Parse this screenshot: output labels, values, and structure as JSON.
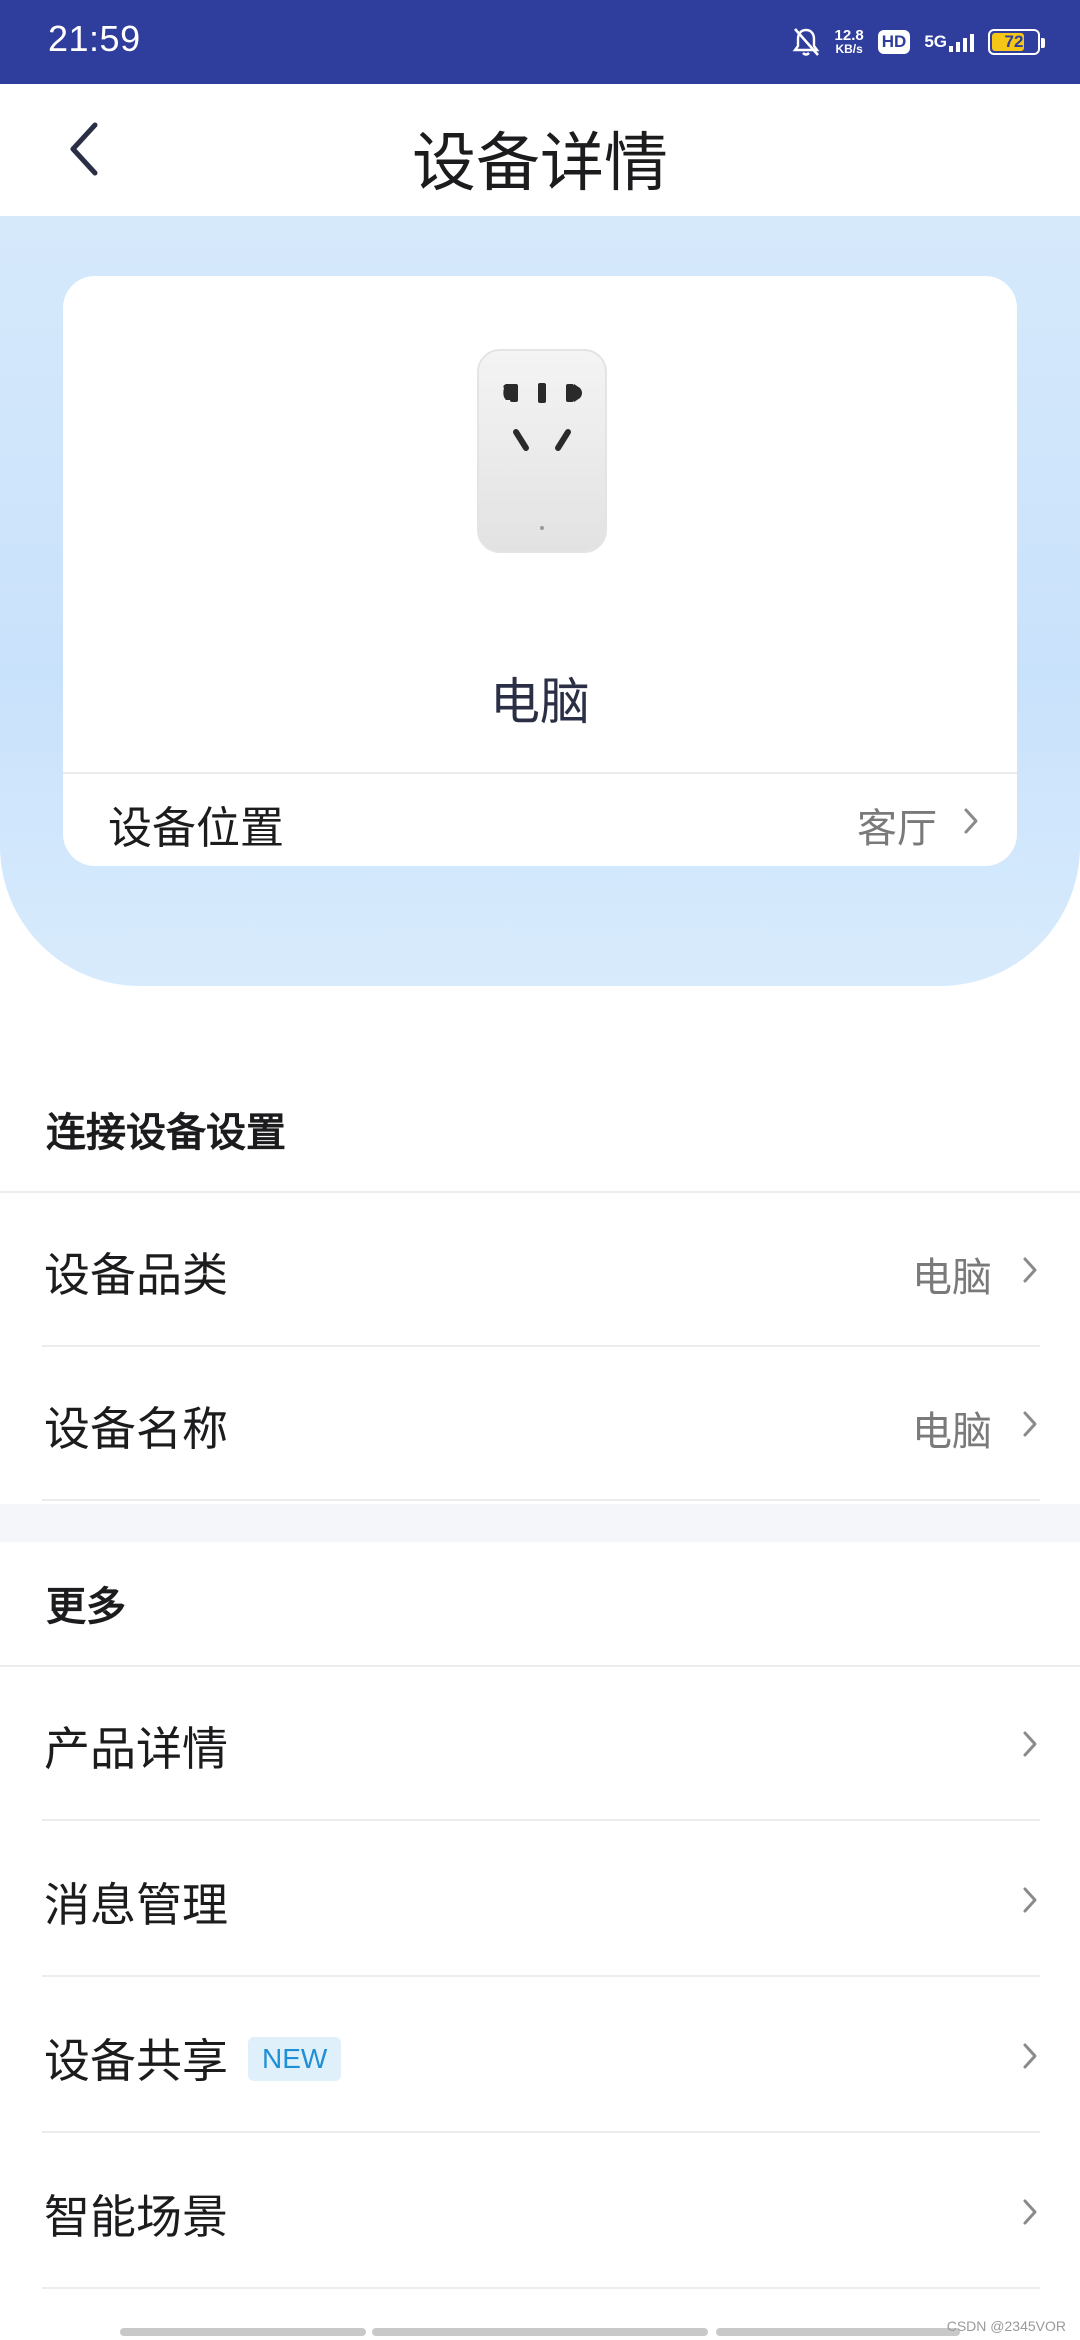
{
  "status_bar": {
    "time": "21:59",
    "speed_value": "12.8",
    "speed_unit": "KB/s",
    "hd": "HD",
    "network": "5G",
    "battery": "72",
    "battery_level": 0.72,
    "icons": [
      "bell-muted-icon",
      "signal-icon",
      "battery-icon"
    ]
  },
  "header": {
    "title": "设备详情",
    "back_icon": "chevron-left-icon"
  },
  "device": {
    "name": "电脑",
    "image": "smart-plug-image",
    "location_label": "设备位置",
    "location_value": "客厅"
  },
  "sections": {
    "connect": {
      "title": "连接设备设置",
      "rows": [
        {
          "label": "设备品类",
          "value": "电脑"
        },
        {
          "label": "设备名称",
          "value": "电脑"
        }
      ]
    },
    "more": {
      "title": "更多",
      "rows": [
        {
          "label": "产品详情"
        },
        {
          "label": "消息管理"
        },
        {
          "label": "设备共享",
          "badge": "NEW"
        },
        {
          "label": "智能场景"
        }
      ]
    }
  },
  "watermark": "CSDN @2345VOR",
  "colors": {
    "status_bar": "#2f3d9c",
    "hero_bg": "#d2e7fb",
    "badge_bg": "#dff0fb",
    "badge_text": "#1f8fd6",
    "battery_fill": "#f5c518"
  }
}
